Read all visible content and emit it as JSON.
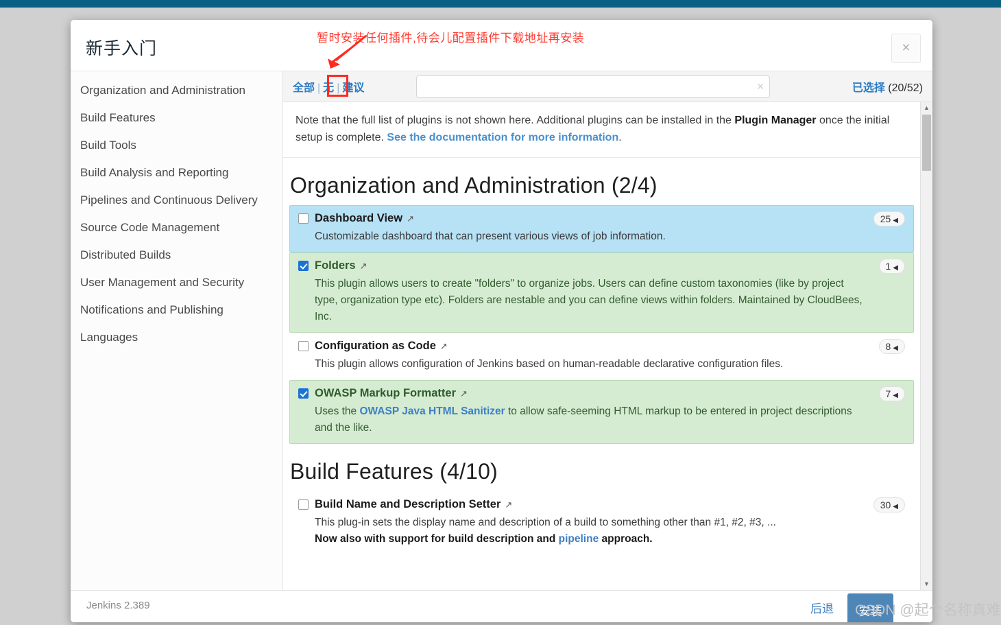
{
  "window": {
    "top_bar_color": "#0a5f85",
    "page_bg": "#d0d0d0"
  },
  "dialog": {
    "title": "新手入门",
    "close_icon": "×"
  },
  "annotation": {
    "text": "暂时安装任何插件,待会儿配置插件下载地址再安装",
    "color": "#ff3b30",
    "arrow_target": "无"
  },
  "sidebar": {
    "items": [
      {
        "label": "Organization and Administration"
      },
      {
        "label": "Build Features"
      },
      {
        "label": "Build Tools"
      },
      {
        "label": "Build Analysis and Reporting"
      },
      {
        "label": "Pipelines and Continuous Delivery"
      },
      {
        "label": "Source Code Management"
      },
      {
        "label": "Distributed Builds"
      },
      {
        "label": "User Management and Security"
      },
      {
        "label": "Notifications and Publishing"
      },
      {
        "label": "Languages"
      }
    ]
  },
  "filterbar": {
    "all_label": "全部",
    "none_label": "无",
    "suggested_label": "建议",
    "separator": "|",
    "search_value": "",
    "search_placeholder": "",
    "search_clear_icon": "×",
    "selected_label": "已选择",
    "selected_count": "(20/52)"
  },
  "note": {
    "part1": "Note that the full list of plugins is not shown here. Additional plugins can be installed in the ",
    "bold1": "Plugin Manager",
    "part2": " once the initial setup is complete. ",
    "link": "See the documentation for more information",
    "part3": "."
  },
  "sections": [
    {
      "heading": "Organization and Administration (2/4)",
      "plugins": [
        {
          "name": "Dashboard View",
          "ext_icon": "↗",
          "description": "Customizable dashboard that can present various views of job information.",
          "badge": "25",
          "badge_tri": "◀",
          "checked": false,
          "state": "hover"
        },
        {
          "name": "Folders",
          "ext_icon": "↗",
          "description": "This plugin allows users to create \"folders\" to organize jobs. Users can define custom taxonomies (like by project type, organization type etc). Folders are nestable and you can define views within folders. Maintained by CloudBees, Inc.",
          "badge": "1",
          "badge_tri": "◀",
          "checked": true,
          "state": "sel"
        },
        {
          "name": "Configuration as Code",
          "ext_icon": "↗",
          "description": "This plugin allows configuration of Jenkins based on human-readable declarative configuration files.",
          "badge": "8",
          "badge_tri": "◀",
          "checked": false,
          "state": "plain"
        },
        {
          "name": "OWASP Markup Formatter",
          "ext_icon": "↗",
          "desc_pre": "Uses the ",
          "desc_link": "OWASP Java HTML Sanitizer",
          "desc_post": " to allow safe-seeming HTML markup to be entered in project descriptions and the like.",
          "badge": "7",
          "badge_tri": "◀",
          "checked": true,
          "state": "sel"
        }
      ]
    },
    {
      "heading": "Build Features (4/10)",
      "plugins": [
        {
          "name": "Build Name and Description Setter",
          "ext_icon": "↗",
          "desc_pre": "This plug-in sets the display name and description of a build to something other than #1, #2, #3, ... ",
          "desc_bold": "Now also with support for build description and ",
          "desc_link": "pipeline",
          "desc_post": " approach.",
          "badge": "30",
          "badge_tri": "◀",
          "checked": false,
          "state": "plain"
        }
      ]
    }
  ],
  "scrollbar": {
    "up_icon": "▲",
    "down_icon": "▼"
  },
  "footer": {
    "version": "Jenkins 2.389",
    "back_label": "后退",
    "install_label": "安装"
  },
  "watermark": "CSDN @起个名称真难"
}
